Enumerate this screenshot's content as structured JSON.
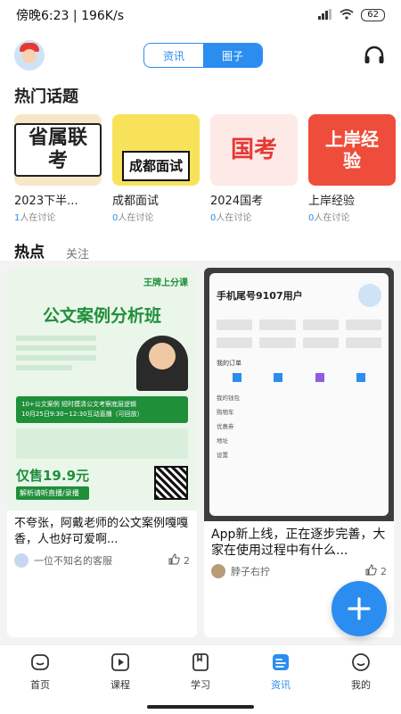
{
  "status": {
    "time": "傍晚6:23",
    "speed": "196K/s",
    "battery": "62"
  },
  "header": {
    "tabs": [
      "资讯",
      "圈子"
    ],
    "active_tab": 1
  },
  "topics_section": {
    "title": "热门话题"
  },
  "topics": [
    {
      "name": "2023下半...",
      "count": "1",
      "suffix": "人在讨论",
      "cover_text": "省属联考",
      "cover_bg": "#f6e7c8"
    },
    {
      "name": "成都面试",
      "count": "0",
      "suffix": "人在讨论",
      "cover_text": "成都面试",
      "cover_bg": "#f8e25a"
    },
    {
      "name": "2024国考",
      "count": "0",
      "suffix": "人在讨论",
      "cover_text": "国考",
      "cover_bg": "#fde9e6"
    },
    {
      "name": "上岸经验",
      "count": "0",
      "suffix": "人在讨论",
      "cover_text": "上岸经验",
      "cover_bg": "#ef4d3c"
    }
  ],
  "feed_tabs": [
    "热点",
    "关注"
  ],
  "posts": [
    {
      "title": "不夸张，阿戴老师的公文案例嘎嘎香，人也好可爱啊...",
      "author": "一位不知名的客服",
      "likes": "2",
      "poster": {
        "brand": "王牌上分课",
        "headline": "公文案例分析班",
        "tagline": "10+公文案例 短时摸清公文考察底层逻辑",
        "date": "10月25日9:30~12:30互动直播（可回放）",
        "price": "仅售19.9元",
        "cta": "解析请听直播/录播"
      }
    },
    {
      "title": "App新上线，正在逐步完善，大家在使用过程中有什么...",
      "author": "脖子右拧",
      "likes": "2",
      "phone": {
        "user": "手机尾号9107用户",
        "orders": "我的订单",
        "menu": [
          "我的钱包",
          "购物车",
          "优惠券",
          "地址",
          "设置"
        ]
      }
    }
  ],
  "bottom_nav": [
    {
      "label": "首页",
      "icon": "home-icon"
    },
    {
      "label": "课程",
      "icon": "play-icon"
    },
    {
      "label": "学习",
      "icon": "book-icon"
    },
    {
      "label": "资讯",
      "icon": "news-icon",
      "active": true
    },
    {
      "label": "我的",
      "icon": "profile-icon"
    }
  ],
  "colors": {
    "accent": "#2b8df0"
  }
}
